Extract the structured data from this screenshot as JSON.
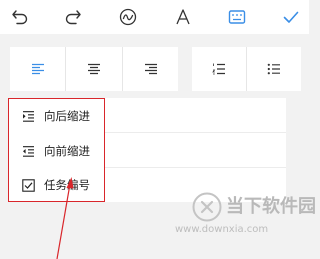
{
  "toolbar": {
    "icons": [
      "undo-icon",
      "redo-icon",
      "handwriting-icon",
      "text-format-icon",
      "keyboard-icon",
      "confirm-check-icon"
    ],
    "accent_color": "#3a8ee6"
  },
  "alignment": {
    "buttons": [
      "align-left-icon",
      "align-center-icon",
      "align-right-icon"
    ],
    "selected": "align-left-icon"
  },
  "list_buttons": [
    "numbered-list-icon",
    "bullet-list-icon"
  ],
  "menu": {
    "items": [
      {
        "label": "向后缩进",
        "icon": "indent-increase-icon"
      },
      {
        "label": "向前缩进",
        "icon": "indent-decrease-icon"
      },
      {
        "label": "任务编号",
        "icon": "task-checkbox-icon"
      }
    ],
    "highlight_color": "#d9262b"
  },
  "watermark": {
    "title": "当下软件园",
    "url": "www.downxia.com"
  }
}
